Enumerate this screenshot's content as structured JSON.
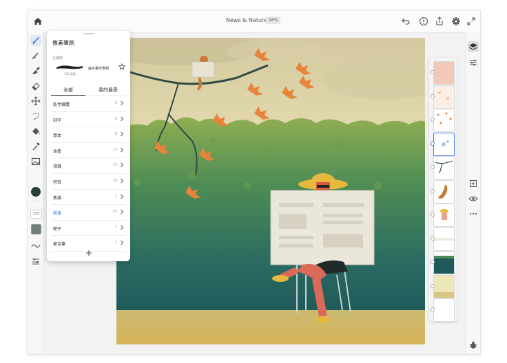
{
  "header": {
    "document_title": "News & Nature",
    "zoom": "98%",
    "icons": [
      "home-icon",
      "undo-icon",
      "help-icon",
      "share-icon",
      "settings-icon",
      "fullscreen-icon"
    ]
  },
  "left_toolbar": {
    "tools": [
      "brush-icon",
      "smudge-icon",
      "fill-brush-icon",
      "eraser-icon",
      "transform-icon",
      "lasso-icon",
      "fill-bucket-icon",
      "eyedropper-icon",
      "image-icon"
    ],
    "color": "#243f3c",
    "brush_size": "125",
    "opacity_swatch": "#6f7f7a"
  },
  "brush_panel": {
    "title": "像素筆刷",
    "selected_label": "已選取",
    "selected_brush": {
      "name": "扁平畫布筆刷",
      "size": "125 像素"
    },
    "tabs": [
      {
        "label": "全部",
        "active": true
      },
      {
        "label": "我的最愛",
        "active": false
      }
    ],
    "categories": [
      {
        "name": "乾性媒體",
        "count": "9",
        "selected": false
      },
      {
        "name": "刻字",
        "count": "8",
        "selected": false
      },
      {
        "name": "基本",
        "count": "8",
        "selected": false
      },
      {
        "name": "油墨",
        "count": "13",
        "selected": false
      },
      {
        "name": "潑灑",
        "count": "13",
        "selected": false
      },
      {
        "name": "特效",
        "count": "19",
        "selected": false
      },
      {
        "name": "素描",
        "count": "2",
        "selected": false
      },
      {
        "name": "繪畫",
        "count": "25",
        "selected": true
      },
      {
        "name": "靶子",
        "count": "7",
        "selected": false
      },
      {
        "name": "麥克筆",
        "count": "2",
        "selected": false
      }
    ],
    "add_icon": "plus-icon"
  },
  "right_toolbar": {
    "icons": [
      "layers-icon",
      "layer-properties-icon",
      "add-layer-icon",
      "visibility-icon",
      "more-icon",
      "bug-icon"
    ]
  },
  "layers": {
    "count": 11,
    "selected_index": 3
  },
  "accent_color": "#3f82e6"
}
